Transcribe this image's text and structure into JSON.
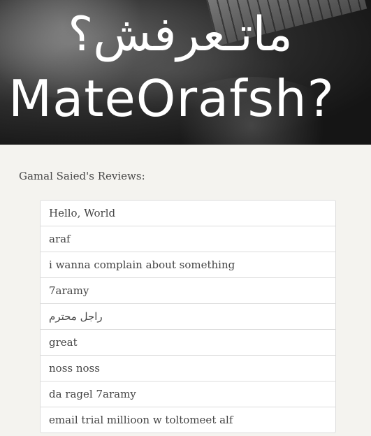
{
  "banner": {
    "logo_arabic": "ماتـعرفش؟",
    "logo_english": "MateOrafsh?"
  },
  "page_title": "Gamal Saied's Reviews:",
  "reviews": [
    "Hello, World",
    "araf",
    "i wanna complain about something",
    "7aramy",
    "راجل محترم",
    "great",
    "noss noss",
    "da ragel 7aramy",
    "email trial millioon w toltomeet alf"
  ]
}
